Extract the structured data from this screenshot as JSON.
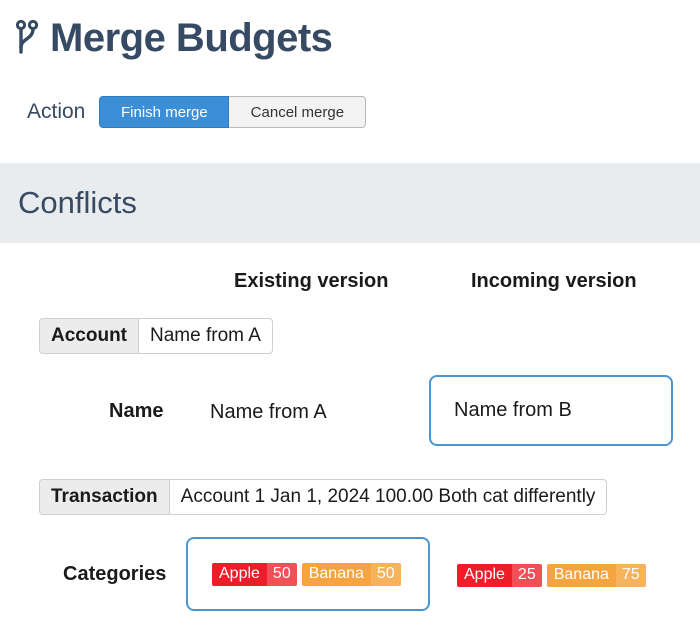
{
  "page": {
    "title": "Merge Budgets",
    "action_label": "Action",
    "finish_label": "Finish merge",
    "cancel_label": "Cancel merge",
    "section_title": "Conflicts"
  },
  "columns": {
    "existing": "Existing version",
    "incoming": "Incoming version"
  },
  "account_tag": {
    "key": "Account",
    "value": "Name from A"
  },
  "name_row": {
    "label": "Name",
    "existing_value": "Name from A",
    "incoming_value": "Name from B"
  },
  "transaction_tag": {
    "key": "Transaction",
    "value": "Account 1 Jan 1, 2024 100.00 Both cat differently"
  },
  "categories_row": {
    "label": "Categories",
    "existing": [
      {
        "name": "Apple",
        "amount": "50"
      },
      {
        "name": "Banana",
        "amount": "50"
      }
    ],
    "incoming": [
      {
        "name": "Apple",
        "amount": "25"
      },
      {
        "name": "Banana",
        "amount": "75"
      }
    ]
  },
  "colors": {
    "heading": "#364a63",
    "primary_button": "#3c8fd6",
    "selection_border": "#4a96d2",
    "apple_name": "#ee1d2a",
    "apple_amount": "#f24f58",
    "banana_name": "#f5a43f",
    "banana_amount": "#f7b25c"
  },
  "icons": {
    "title_icon": "git-merge-icon"
  }
}
